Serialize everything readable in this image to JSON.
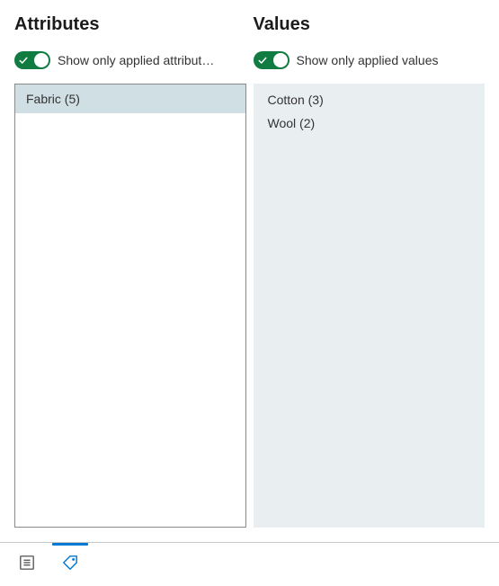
{
  "attributes": {
    "header": "Attributes",
    "toggle_label": "Show only applied attribut…",
    "items": [
      {
        "label": "Fabric",
        "count": 5
      }
    ]
  },
  "values": {
    "header": "Values",
    "toggle_label": "Show only applied values",
    "items": [
      {
        "label": "Cotton",
        "count": 3
      },
      {
        "label": "Wool",
        "count": 2
      }
    ]
  }
}
